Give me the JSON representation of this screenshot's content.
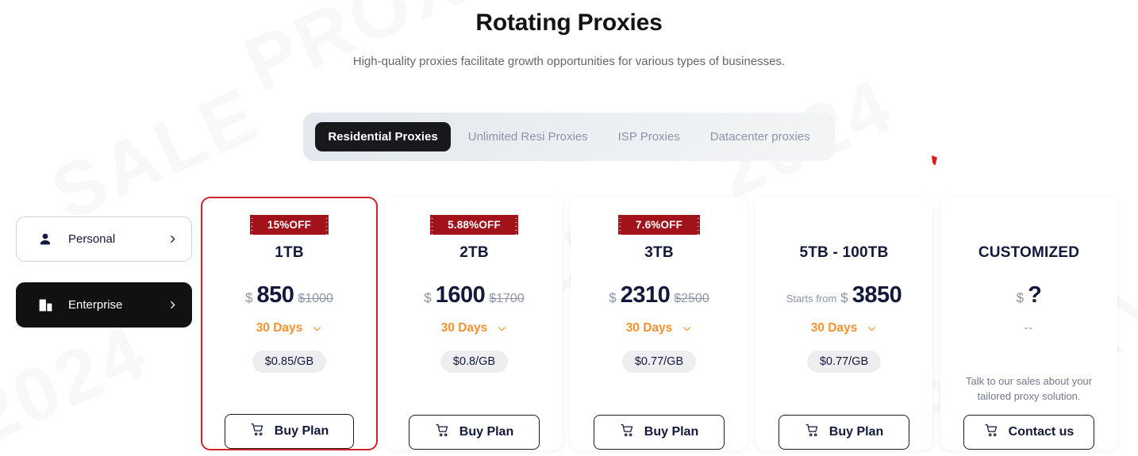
{
  "header": {
    "title": "Rotating Proxies",
    "subtitle": "High-quality proxies facilitate growth opportunities for various types of businesses."
  },
  "tabs": [
    {
      "label": "Residential Proxies",
      "active": true
    },
    {
      "label": "Unlimited Resi Proxies",
      "active": false
    },
    {
      "label": "ISP Proxies",
      "active": false
    },
    {
      "label": "Datacenter proxies",
      "active": false
    }
  ],
  "sidebar": {
    "items": [
      {
        "label": "Personal",
        "icon": "person-icon",
        "chevron": "chevron-right-icon",
        "selected": false
      },
      {
        "label": "Enterprise",
        "icon": "building-icon",
        "chevron": "chevron-right-icon",
        "selected": true
      }
    ]
  },
  "colors": {
    "accent_red": "#d4222c",
    "badge_red": "#a2121b",
    "term_orange": "#f5922f",
    "price_navy": "#13193a",
    "muted_gray": "#8a93a8"
  },
  "cards": [
    {
      "badge": "15%OFF",
      "plan_name": "1TB",
      "price_prefix": "",
      "currency": "$",
      "price": "850",
      "price_old": "$1000",
      "term": "30 Days",
      "rate": "$0.85/GB",
      "blurb": "",
      "cta": "Buy Plan",
      "selected": true
    },
    {
      "badge": "5.88%OFF",
      "plan_name": "2TB",
      "price_prefix": "",
      "currency": "$",
      "price": "1600",
      "price_old": "$1700",
      "term": "30 Days",
      "rate": "$0.8/GB",
      "blurb": "",
      "cta": "Buy Plan",
      "selected": false
    },
    {
      "badge": "7.6%OFF",
      "plan_name": "3TB",
      "price_prefix": "",
      "currency": "$",
      "price": "2310",
      "price_old": "$2500",
      "term": "30 Days",
      "rate": "$0.77/GB",
      "blurb": "",
      "cta": "Buy Plan",
      "selected": false
    },
    {
      "badge": "",
      "plan_name": "5TB - 100TB",
      "price_prefix": "Starts from",
      "currency": "$",
      "price": "3850",
      "price_old": "",
      "term": "30 Days",
      "rate": "$0.77/GB",
      "blurb": "",
      "cta": "Buy Plan",
      "selected": false
    },
    {
      "badge": "",
      "plan_name": "CUSTOMIZED",
      "price_prefix": "",
      "currency": "$",
      "price": "?",
      "price_old": "",
      "term": "--",
      "rate": "",
      "blurb": "Talk to our sales about your tailored proxy solution.",
      "cta": "Contact us",
      "selected": false
    }
  ],
  "watermark": {
    "lines": [
      "2024",
      "PROXY",
      "SALE",
      "2024",
      "PROXY",
      "SALE"
    ]
  }
}
